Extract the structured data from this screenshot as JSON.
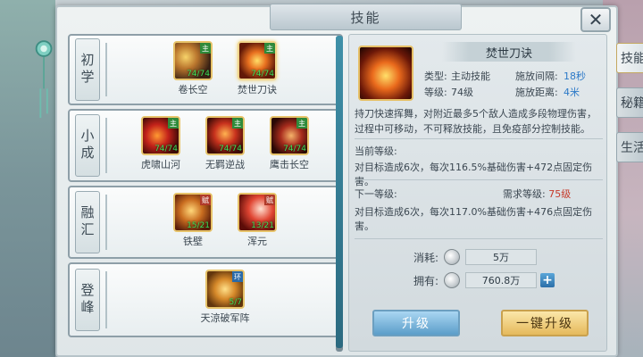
{
  "window": {
    "title": "技能"
  },
  "close": {
    "label": "✕"
  },
  "side_tabs": [
    "技能",
    "秘籍",
    "生活"
  ],
  "rows": [
    {
      "label": "初学",
      "skills": [
        {
          "name": "卷长空",
          "level": "74/74",
          "badge": "主",
          "style": "ic-a"
        },
        {
          "name": "焚世刀诀",
          "level": "74/74",
          "badge": "主",
          "style": "ic-b",
          "selected": true
        }
      ]
    },
    {
      "label": "小成",
      "skills": [
        {
          "name": "虎啸山河",
          "level": "74/74",
          "badge": "主",
          "style": "ic-c"
        },
        {
          "name": "无羁逆战",
          "level": "74/74",
          "badge": "主",
          "style": "ic-d"
        },
        {
          "name": "鹰击长空",
          "level": "74/74",
          "badge": "主",
          "style": "ic-e"
        }
      ]
    },
    {
      "label": "融汇",
      "skills": [
        {
          "name": "铁壁",
          "level": "15/21",
          "badge": "赋",
          "style": "ic-f"
        },
        {
          "name": "浑元",
          "level": "13/21",
          "badge": "赋",
          "style": "ic-g"
        }
      ]
    },
    {
      "label": "登峰",
      "skills": [
        {
          "name": "天涼破军阵",
          "level": "5/7",
          "badge": "环",
          "style": "ic-h"
        }
      ]
    }
  ],
  "detail": {
    "name": "焚世刀诀",
    "type_label": "类型:",
    "type_value": "主动技能",
    "interval_label": "施放间隔:",
    "interval_value": "18秒",
    "level_label": "等级:",
    "level_value": "74级",
    "distance_label": "施放距离:",
    "distance_value": "4米",
    "description": "持刀快速挥舞，对附近最多5个敌人造成多段物理伤害，过程中可移动，不可释放技能，且免疫部分控制技能。",
    "current_header": "当前等级:",
    "current_line": "对目标造成6次，每次116.5%基础伤害+472点固定伤害。",
    "next_header": "下一等级:",
    "req_label": "需求等级:",
    "req_value": "75级",
    "next_line": "对目标造成6次，每次117.0%基础伤害+476点固定伤害。",
    "cost_label": "消耗:",
    "cost_value": "5万",
    "own_label": "拥有:",
    "own_value": "760.8万",
    "plus_label": "+"
  },
  "buttons": {
    "upgrade": "升级",
    "one_key": "一键升级"
  }
}
